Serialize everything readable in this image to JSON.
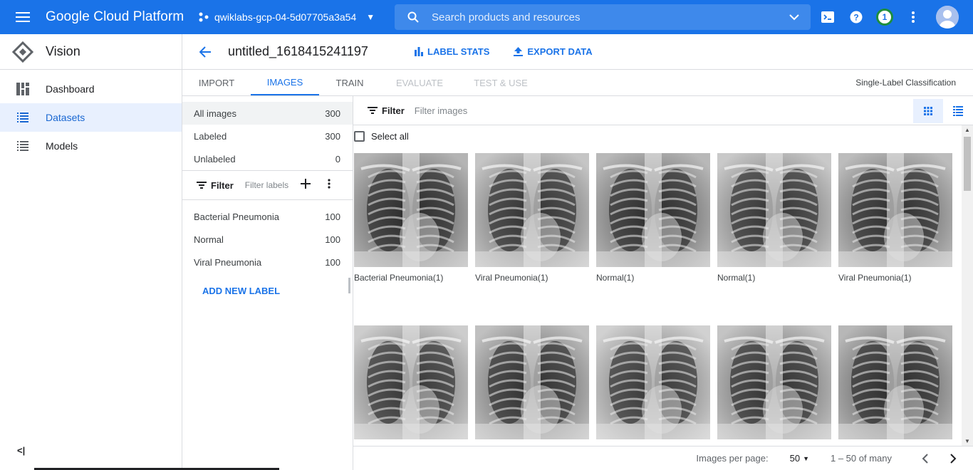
{
  "topbar": {
    "brand": "Google Cloud Platform",
    "project": "qwiklabs-gcp-04-5d07705a3a54",
    "search_placeholder": "Search products and resources",
    "notification_count": "1"
  },
  "nav": {
    "product": "Vision",
    "items": [
      {
        "label": "Dashboard",
        "icon": "dashboard-icon"
      },
      {
        "label": "Datasets",
        "icon": "list-icon"
      },
      {
        "label": "Models",
        "icon": "list-icon"
      }
    ],
    "collapse_label": "<|"
  },
  "header": {
    "title": "untitled_1618415241197",
    "label_stats": "LABEL STATS",
    "export_data": "EXPORT DATA"
  },
  "tabs": {
    "items": [
      "IMPORT",
      "IMAGES",
      "TRAIN",
      "EVALUATE",
      "TEST & USE"
    ],
    "active": "IMAGES",
    "type_label": "Single-Label Classification"
  },
  "label_panel": {
    "summary": [
      {
        "label": "All images",
        "count": "300"
      },
      {
        "label": "Labeled",
        "count": "300"
      },
      {
        "label": "Unlabeled",
        "count": "0"
      }
    ],
    "filter_label": "Filter",
    "filter_placeholder": "Filter labels",
    "labels": [
      {
        "label": "Bacterial Pneumonia",
        "count": "100"
      },
      {
        "label": "Normal",
        "count": "100"
      },
      {
        "label": "Viral Pneumonia",
        "count": "100"
      }
    ],
    "add_label": "ADD NEW LABEL"
  },
  "grid": {
    "filter_label": "Filter",
    "filter_placeholder": "Filter images",
    "select_all": "Select all",
    "images": [
      {
        "caption": "Bacterial Pneumonia(1)"
      },
      {
        "caption": "Viral Pneumonia(1)"
      },
      {
        "caption": "Normal(1)"
      },
      {
        "caption": "Normal(1)"
      },
      {
        "caption": "Viral Pneumonia(1)"
      },
      {
        "caption": ""
      },
      {
        "caption": ""
      },
      {
        "caption": ""
      },
      {
        "caption": ""
      },
      {
        "caption": ""
      }
    ]
  },
  "pager": {
    "per_page_label": "Images per page:",
    "per_page": "50",
    "range": "1 – 50 of many"
  },
  "colors": {
    "primary": "#1a73e8",
    "active_bg": "#e8f0fe"
  }
}
